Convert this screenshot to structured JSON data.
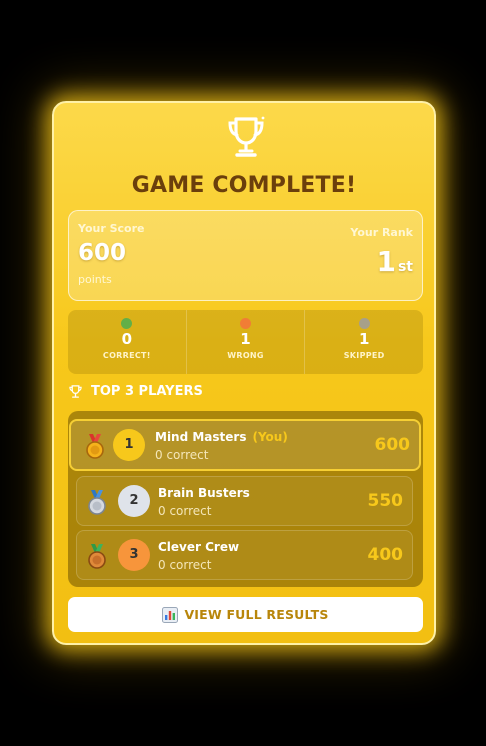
{
  "title": "GAME COMPLETE!",
  "score": {
    "label": "Your Score",
    "value": "600",
    "unit": "points",
    "rank_label": "Your Rank",
    "rank_value": "1",
    "rank_suffix": "st"
  },
  "stats": [
    {
      "value": "0",
      "label": "CORRECT!",
      "color": "#4caf50"
    },
    {
      "value": "1",
      "label": "WRONG",
      "color": "#f4743b"
    },
    {
      "value": "1",
      "label": "SKIPPED",
      "color": "#9e9e9e"
    }
  ],
  "leaderboard": {
    "title": "TOP 3 PLAYERS",
    "players": [
      {
        "rank": "1",
        "name": "Mind Masters",
        "you_tag": "(You)",
        "correct": "0 correct",
        "score": "600",
        "medal": "gold-medal-icon",
        "circle_color": "#f7c81b"
      },
      {
        "rank": "2",
        "name": "Brain Busters",
        "correct": "0 correct",
        "score": "550",
        "medal": "silver-medal-icon",
        "circle_color": "#dfe3ea"
      },
      {
        "rank": "3",
        "name": "Clever Crew",
        "correct": "0 correct",
        "score": "400",
        "medal": "bronze-medal-icon",
        "circle_color": "#f7953b"
      }
    ]
  },
  "button": {
    "label": "VIEW FULL RESULTS",
    "icon": "bar-chart-icon"
  },
  "colors": {
    "accent": "#f7c81b",
    "title": "#6b3f0c",
    "button_text": "#b8860b"
  }
}
